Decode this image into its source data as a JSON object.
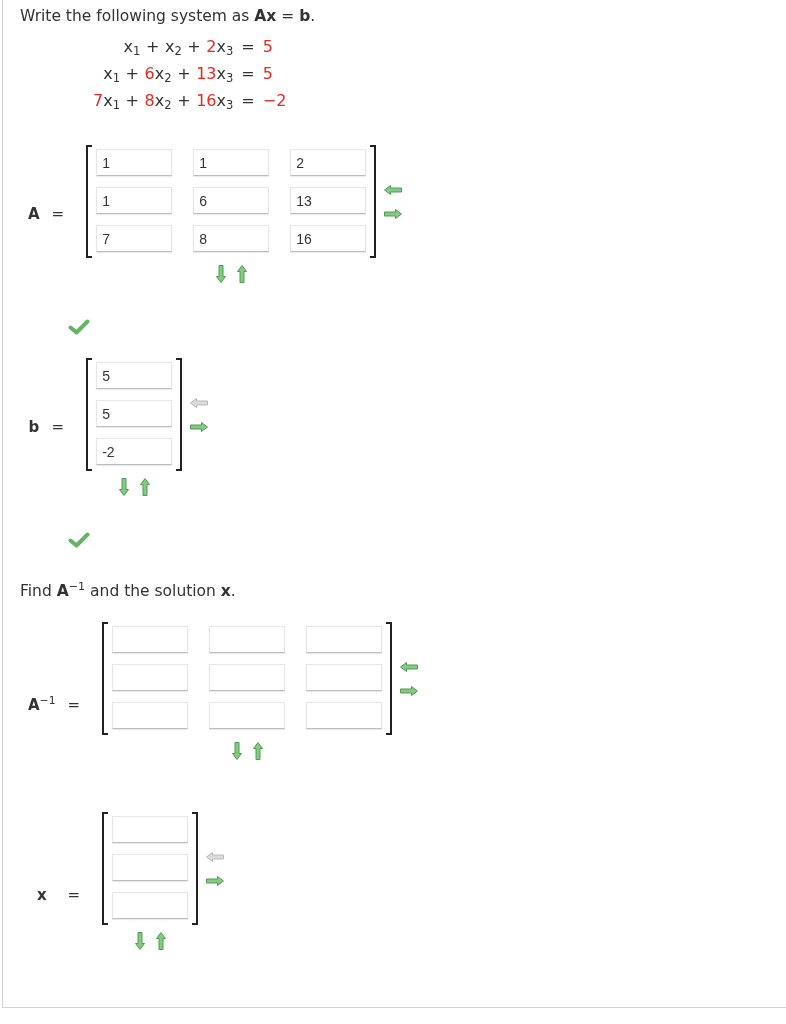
{
  "parts": [
    {
      "instruction": "Write the following system as **Ax** = **b**.",
      "system": [
        {
          "terms": [
            {
              "variable": "x$_{1}$"
            },
            {
              "sign": "+",
              "variable": "x$_{2}$"
            },
            {
              "sign": "+",
              "coefficient": "2",
              "variable": "x$_{3}$"
            }
          ],
          "relation": "=",
          "constant": "5"
        },
        {
          "terms": [
            {
              "variable": "x$_{1}$"
            },
            {
              "sign": "+",
              "coefficient": "6",
              "variable": "x$_{2}$"
            },
            {
              "sign": "+",
              "coefficient": "13",
              "variable": "x$_{3}$"
            }
          ],
          "relation": "=",
          "constant": "5"
        },
        {
          "terms": [
            {
              "coefficient": "7",
              "variable": "x$_{1}$"
            },
            {
              "sign": "+",
              "coefficient": "8",
              "variable": "x$_{2}$"
            },
            {
              "sign": "+",
              "coefficient": "16",
              "variable": "x$_{3}$"
            }
          ],
          "relation": "=",
          "constant": "−2"
        }
      ],
      "matrices": [
        {
          "name": "A",
          "relation": "=",
          "rows": [
            [
              {
                "kind": "input",
                "value": "1"
              },
              {
                "kind": "input",
                "value": "1"
              },
              {
                "kind": "input",
                "value": "2"
              }
            ],
            [
              {
                "kind": "input",
                "value": "1"
              },
              {
                "kind": "input",
                "value": "6"
              },
              {
                "kind": "input",
                "value": "13"
              }
            ],
            [
              {
                "kind": "input",
                "value": "7"
              },
              {
                "kind": "input",
                "value": "8"
              },
              {
                "kind": "input",
                "value": "16"
              }
            ]
          ],
          "controls": [
            {
              "kind": "remove-column",
              "disabled": false
            },
            {
              "kind": "add-column",
              "disabled": false
            },
            {
              "kind": "remove-row",
              "disabled": false
            },
            {
              "kind": "add-row",
              "disabled": false
            }
          ],
          "correct": true
        },
        {
          "name": "b",
          "relation": "=",
          "rows": [
            [
              {
                "kind": "input",
                "value": "5"
              }
            ],
            [
              {
                "kind": "input",
                "value": "5"
              }
            ],
            [
              {
                "kind": "input",
                "value": "-2"
              }
            ]
          ],
          "controls": [
            {
              "kind": "remove-column",
              "disabled": true
            },
            {
              "kind": "add-column",
              "disabled": false
            },
            {
              "kind": "remove-row",
              "disabled": false
            },
            {
              "kind": "add-row",
              "disabled": false
            }
          ],
          "correct": true
        }
      ]
    },
    {
      "instruction": "Find **A**$^{−1}$ and the solution **x**.",
      "matrices": [
        {
          "name": "A$^{−1}$",
          "relation": "=",
          "rows": [
            [
              {
                "kind": "input"
              },
              {
                "kind": "input"
              },
              {
                "kind": "input"
              }
            ],
            [
              {
                "kind": "input"
              },
              {
                "kind": "input"
              },
              {
                "kind": "input"
              }
            ],
            [
              {
                "kind": "input"
              },
              {
                "kind": "input"
              },
              {
                "kind": "input"
              }
            ]
          ],
          "controls": [
            {
              "kind": "remove-column",
              "disabled": false
            },
            {
              "kind": "add-column",
              "disabled": false
            },
            {
              "kind": "remove-row",
              "disabled": false
            },
            {
              "kind": "add-row",
              "disabled": false
            }
          ]
        },
        {
          "name": "x",
          "relation": "=",
          "rows": [
            [
              {
                "kind": "input"
              }
            ],
            [
              {
                "kind": "input"
              }
            ],
            [
              {
                "kind": "input"
              }
            ]
          ],
          "controls": [
            {
              "kind": "remove-column",
              "disabled": true
            },
            {
              "kind": "add-column",
              "disabled": false
            },
            {
              "kind": "remove-row",
              "disabled": false
            },
            {
              "kind": "add-row",
              "disabled": false
            }
          ]
        }
      ]
    }
  ]
}
